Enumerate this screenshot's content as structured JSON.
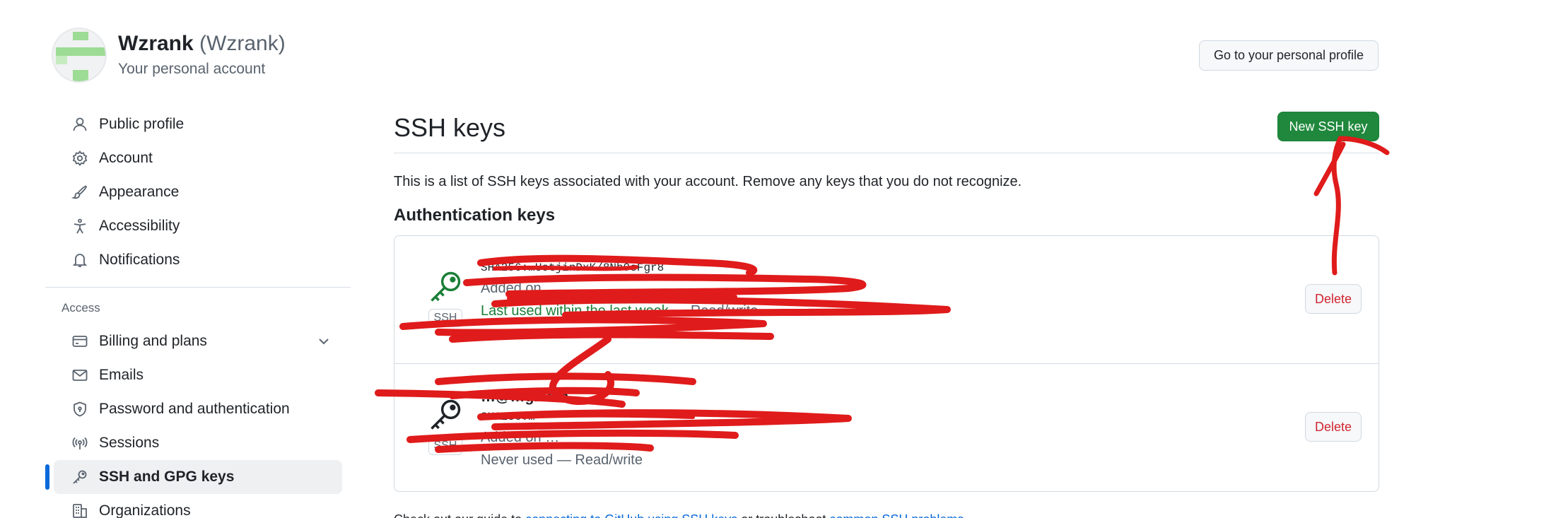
{
  "account": {
    "name": "Wzrank",
    "handle": "(Wzrank)",
    "subtitle": "Your personal account"
  },
  "header": {
    "profile_button": "Go to your personal profile"
  },
  "sidebar": {
    "items": [
      {
        "label": "Public profile",
        "icon": "person-icon"
      },
      {
        "label": "Account",
        "icon": "gear-icon"
      },
      {
        "label": "Appearance",
        "icon": "paintbrush-icon"
      },
      {
        "label": "Accessibility",
        "icon": "accessibility-icon"
      },
      {
        "label": "Notifications",
        "icon": "bell-icon"
      }
    ],
    "access_label": "Access",
    "access_items": [
      {
        "label": "Billing and plans",
        "icon": "credit-card-icon"
      },
      {
        "label": "Emails",
        "icon": "mail-icon"
      },
      {
        "label": "Password and authentication",
        "icon": "shield-lock-icon"
      },
      {
        "label": "Sessions",
        "icon": "broadcast-icon"
      },
      {
        "label": "SSH and GPG keys",
        "icon": "key-icon"
      },
      {
        "label": "Organizations",
        "icon": "organization-icon"
      }
    ]
  },
  "main": {
    "title": "SSH keys",
    "new_button": "New SSH key",
    "intro": "This is a list of SSH keys associated with your account. Remove any keys that you do not recognize.",
    "section_heading": "Authentication keys",
    "keys": [
      {
        "title": "",
        "fingerprint": "SHA256:…UotjinDxK/8Nb9eFgr8",
        "added": "Added on …",
        "usage_recent": "Last used within the last week",
        "usage_suffix": " — Read/write",
        "badge": "SSH",
        "delete_label": "Delete"
      },
      {
        "title": "…@…g.com",
        "fingerprint": "SHA256:…",
        "added": "Added on …",
        "usage_recent": "",
        "usage_suffix": "Never used — Read/write",
        "badge": "SSH",
        "delete_label": "Delete"
      }
    ],
    "footer": {
      "prefix": "Check out our guide to ",
      "link1": "connecting to GitHub using SSH keys",
      "middle": " or troubleshoot ",
      "link2": "common SSH problems",
      "suffix": "."
    }
  },
  "colors": {
    "primary_button": "#1f883d",
    "active_indicator": "#0969da",
    "danger": "#d1242f",
    "recent_key": "#1a7f37",
    "scribble": "#e01b1b"
  }
}
